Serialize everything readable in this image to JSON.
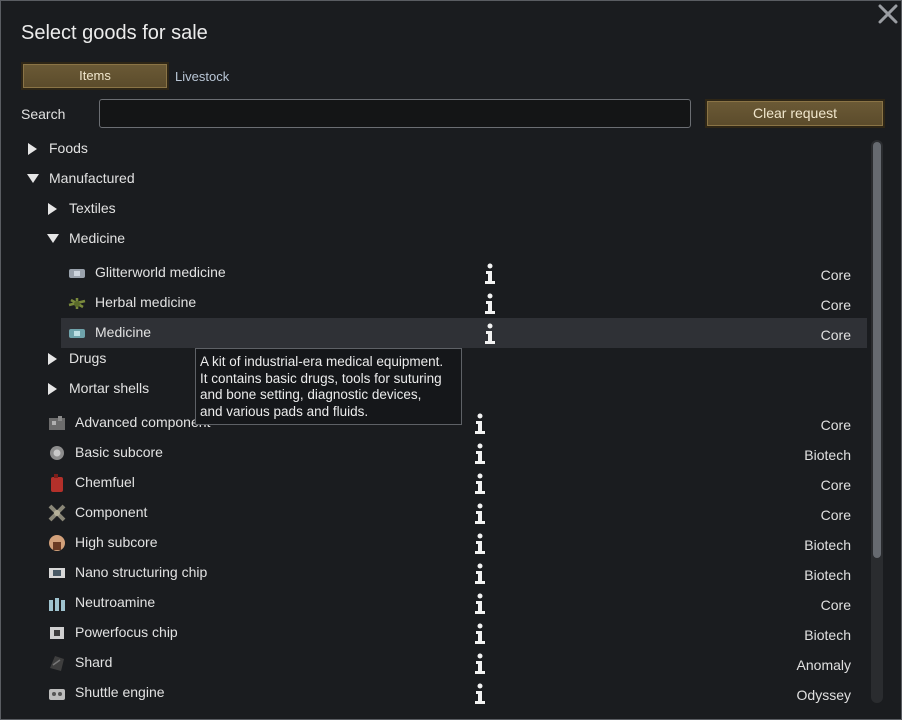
{
  "dialog": {
    "title": "Select goods for sale",
    "close_icon": "close-x-icon"
  },
  "tabs": [
    {
      "label": "Items",
      "active": true
    },
    {
      "label": "Livestock",
      "active": false
    }
  ],
  "search": {
    "label": "Search",
    "value": "",
    "placeholder": ""
  },
  "clear_button": "Clear request",
  "tree": {
    "foods": "Foods",
    "manufactured": "Manufactured",
    "textiles": "Textiles",
    "medicine_category": "Medicine",
    "drugs": "Drugs",
    "mortar_shells": "Mortar shells"
  },
  "medicine_items": [
    {
      "label": "Glitterworld medicine",
      "source": "Core",
      "icon": "glitterworld-medicine-icon"
    },
    {
      "label": "Herbal medicine",
      "source": "Core",
      "icon": "herbal-medicine-icon"
    },
    {
      "label": "Medicine",
      "source": "Core",
      "icon": "medicine-kit-icon"
    }
  ],
  "manufactured_items": [
    {
      "label": "Advanced component",
      "source": "Core",
      "icon": "advanced-component-icon"
    },
    {
      "label": "Basic subcore",
      "source": "Biotech",
      "icon": "basic-subcore-icon"
    },
    {
      "label": "Chemfuel",
      "source": "Core",
      "icon": "chemfuel-icon"
    },
    {
      "label": "Component",
      "source": "Core",
      "icon": "component-icon"
    },
    {
      "label": "High subcore",
      "source": "Biotech",
      "icon": "high-subcore-icon"
    },
    {
      "label": "Nano structuring chip",
      "source": "Biotech",
      "icon": "nano-chip-icon"
    },
    {
      "label": "Neutroamine",
      "source": "Core",
      "icon": "neutroamine-icon"
    },
    {
      "label": "Powerfocus chip",
      "source": "Biotech",
      "icon": "powerfocus-chip-icon"
    },
    {
      "label": "Shard",
      "source": "Anomaly",
      "icon": "shard-icon"
    },
    {
      "label": "Shuttle engine",
      "source": "Odyssey",
      "icon": "shuttle-engine-icon"
    }
  ],
  "tooltip": {
    "line1": "A kit of industrial-era medical equipment.",
    "line2": "It contains basic drugs, tools for suturing",
    "line3": "and bone setting, diagnostic devices,",
    "line4": "and various pads and fluids."
  },
  "colors": {
    "button_gold": "#6b5a36",
    "background": "#1a1c1f",
    "highlight_row": "#2f3136"
  }
}
